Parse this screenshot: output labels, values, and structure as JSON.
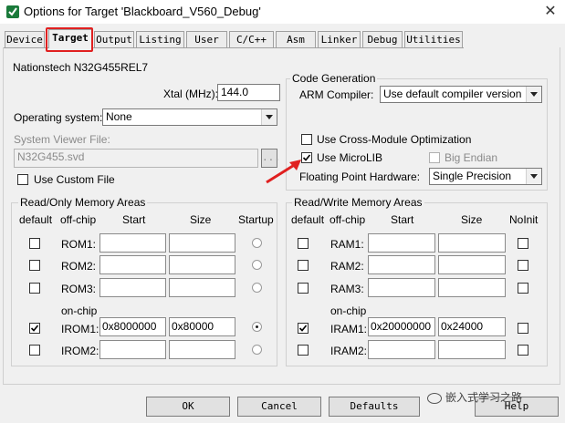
{
  "window": {
    "title": "Options for Target 'Blackboard_V560_Debug'",
    "close": "✕"
  },
  "tabs": [
    {
      "label": "Device"
    },
    {
      "label": "Target"
    },
    {
      "label": "Output"
    },
    {
      "label": "Listing"
    },
    {
      "label": "User"
    },
    {
      "label": "C/C++"
    },
    {
      "label": "Asm"
    },
    {
      "label": "Linker"
    },
    {
      "label": "Debug"
    },
    {
      "label": "Utilities"
    }
  ],
  "active_tab": "Target",
  "device_name": "Nationstech N32G455REL7",
  "xtal": {
    "label": "Xtal (MHz):",
    "value": "144.0"
  },
  "os": {
    "label": "Operating system:",
    "value": "None"
  },
  "svd": {
    "label": "System Viewer File:",
    "value": "N32G455.svd",
    "browse": "..."
  },
  "custom_file": {
    "label": "Use Custom File",
    "checked": false
  },
  "code_gen": {
    "title": "Code Generation",
    "arm_compiler_label": "ARM Compiler:",
    "arm_compiler_value": "Use default compiler version",
    "cross_module": {
      "label": "Use Cross-Module Optimization",
      "checked": false
    },
    "microlib": {
      "label": "Use MicroLIB",
      "checked": true
    },
    "big_endian": {
      "label": "Big Endian",
      "checked": false
    },
    "fp_label": "Floating Point Hardware:",
    "fp_value": "Single Precision"
  },
  "ro_mem": {
    "title": "Read/Only Memory Areas",
    "headers": {
      "default": "default",
      "offchip": "off-chip",
      "start": "Start",
      "size": "Size",
      "last": "Startup"
    },
    "onchip_label": "on-chip",
    "rows": [
      {
        "name": "ROM1:",
        "start": "",
        "size": "",
        "checked": false,
        "selected": false
      },
      {
        "name": "ROM2:",
        "start": "",
        "size": "",
        "checked": false,
        "selected": false
      },
      {
        "name": "ROM3:",
        "start": "",
        "size": "",
        "checked": false,
        "selected": false
      },
      {
        "name": "IROM1:",
        "start": "0x8000000",
        "size": "0x80000",
        "checked": true,
        "selected": true
      },
      {
        "name": "IROM2:",
        "start": "",
        "size": "",
        "checked": false,
        "selected": false
      }
    ]
  },
  "rw_mem": {
    "title": "Read/Write Memory Areas",
    "headers": {
      "default": "default",
      "offchip": "off-chip",
      "start": "Start",
      "size": "Size",
      "last": "NoInit"
    },
    "onchip_label": "on-chip",
    "rows": [
      {
        "name": "RAM1:",
        "start": "",
        "size": "",
        "checked": false,
        "noinit": false
      },
      {
        "name": "RAM2:",
        "start": "",
        "size": "",
        "checked": false,
        "noinit": false
      },
      {
        "name": "RAM3:",
        "start": "",
        "size": "",
        "checked": false,
        "noinit": false
      },
      {
        "name": "IRAM1:",
        "start": "0x20000000",
        "size": "0x24000",
        "checked": true,
        "noinit": false
      },
      {
        "name": "IRAM2:",
        "start": "",
        "size": "",
        "checked": false,
        "noinit": false
      }
    ]
  },
  "buttons": {
    "ok": "OK",
    "cancel": "Cancel",
    "defaults": "Defaults",
    "help": "Help"
  },
  "watermark": "嵌入式学习之路",
  "colors": {
    "highlight": "#e02020",
    "arrow": "#e02020"
  }
}
